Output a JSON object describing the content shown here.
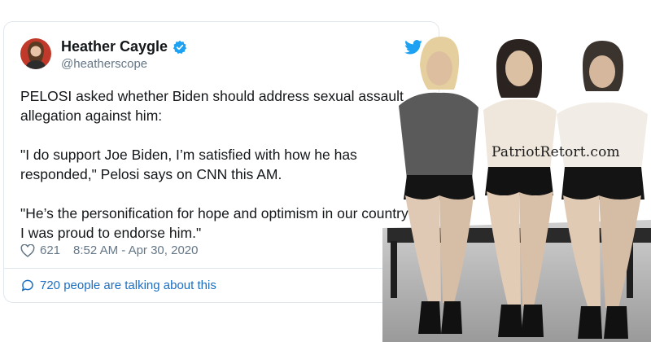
{
  "tweet": {
    "author_name": "Heather Caygle",
    "author_handle": "@heatherscope",
    "paragraphs": [
      "PELOSI asked whether Biden should address sexual assault",
      "allegation against him:",
      "\"I do support Joe Biden, I’m satisfied with how he has",
      "responded,\" Pelosi says on CNN this AM.",
      "\"He’s the personification for hope and optimism in our country",
      "I was proud to endorse him.\""
    ],
    "likes": "621",
    "timestamp": "8:52 AM - Apr 30, 2020",
    "talking_text": "720 people are talking about this"
  },
  "icons": {
    "verified": "verified-badge-icon",
    "logo": "twitter-bird-icon",
    "likes": "heart-icon",
    "talking": "chat-bubble-icon"
  },
  "colors": {
    "verified": "#1da1f2",
    "link": "#1b6ec2",
    "meta": "#657786"
  },
  "meme": {
    "watermark": "PatriotRetort.com"
  }
}
